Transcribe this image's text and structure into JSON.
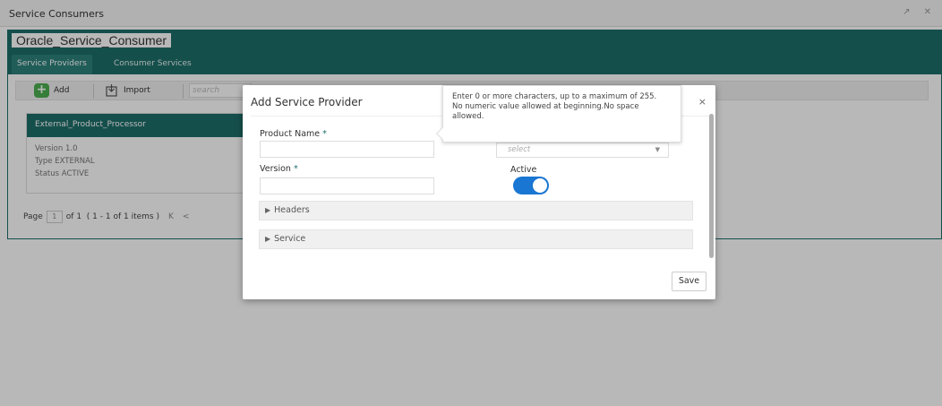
{
  "window": {
    "title": "Service Consumers",
    "controls": "↗ ✕"
  },
  "app": {
    "name": "Oracle_Service_Consumer"
  },
  "tabs": [
    {
      "label": "Service Providers",
      "active": true
    },
    {
      "label": "Consumer Services",
      "active": false
    }
  ],
  "toolbar": {
    "add_label": "Add",
    "add_icon": "plus-icon",
    "import_label": "Import",
    "import_icon": "import-icon",
    "search_placeholder": "search"
  },
  "card": {
    "name": "External_Product_Processor",
    "version": "Version  1.0",
    "type": "Type    EXTERNAL",
    "status": "Status   ACTIVE"
  },
  "pager": {
    "page_label": "Page",
    "page_value": "1",
    "of_label": "of 1",
    "range": "( 1 - 1 of 1 items )",
    "first": "K",
    "prev": "<"
  },
  "modal": {
    "title": "Add Service Provider",
    "close": "×",
    "product_name_label": "Product Name",
    "product_name_value": "",
    "version_label": "Version",
    "version_value": "",
    "required_marker": "*",
    "select_placeholder": "select",
    "active_label": "Active",
    "active_state": true,
    "headers_label": "Headers",
    "service_label": "Service",
    "save_label": "Save"
  },
  "tooltip": {
    "line1": "Enter 0 or more characters, up to a maximum of 255.",
    "line2": "No numeric value allowed at beginning.No space allowed."
  },
  "colors": {
    "brand": "#1e6e6a",
    "toggle_on": "#1976d2",
    "add_green": "#4caf50"
  }
}
